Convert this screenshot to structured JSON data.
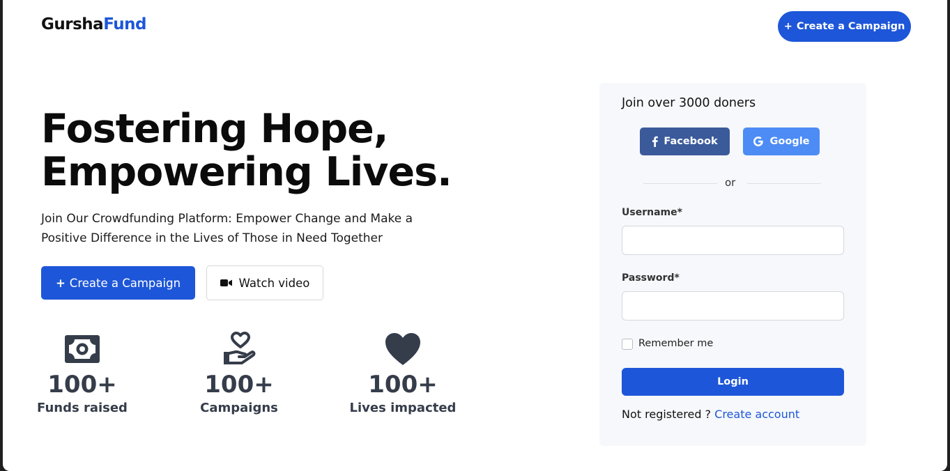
{
  "header": {
    "logo_part1": "Gursha",
    "logo_part2": "Fund",
    "cta_label": "Create a Campaign"
  },
  "hero": {
    "title_line1": "Fostering Hope,",
    "title_line2": "Empowering Lives.",
    "subtitle": "Join Our Crowdfunding Platform: Empower Change and Make a Positive Difference in the Lives of Those in Need Together",
    "primary_button": "Create a Campaign",
    "video_button": "Watch video"
  },
  "stats": [
    {
      "icon": "money-icon",
      "value": "100+",
      "label": "Funds raised"
    },
    {
      "icon": "hand-heart-icon",
      "value": "100+",
      "label": "Campaigns"
    },
    {
      "icon": "heart-icon",
      "value": "100+",
      "label": "Lives impacted"
    }
  ],
  "login": {
    "title": "Join over 3000 doners",
    "facebook_label": "Facebook",
    "google_label": "Google",
    "divider_text": "or",
    "username_label": "Username*",
    "username_value": "",
    "password_label": "Password*",
    "password_value": "",
    "remember_label": "Remember me",
    "login_button": "Login",
    "register_prompt": "Not registered ?",
    "register_link": "Create account"
  },
  "colors": {
    "accent": "#1d56d8",
    "facebook": "#3b5a9a",
    "google": "#4d8cf5",
    "stat_icon": "#353c4a"
  }
}
